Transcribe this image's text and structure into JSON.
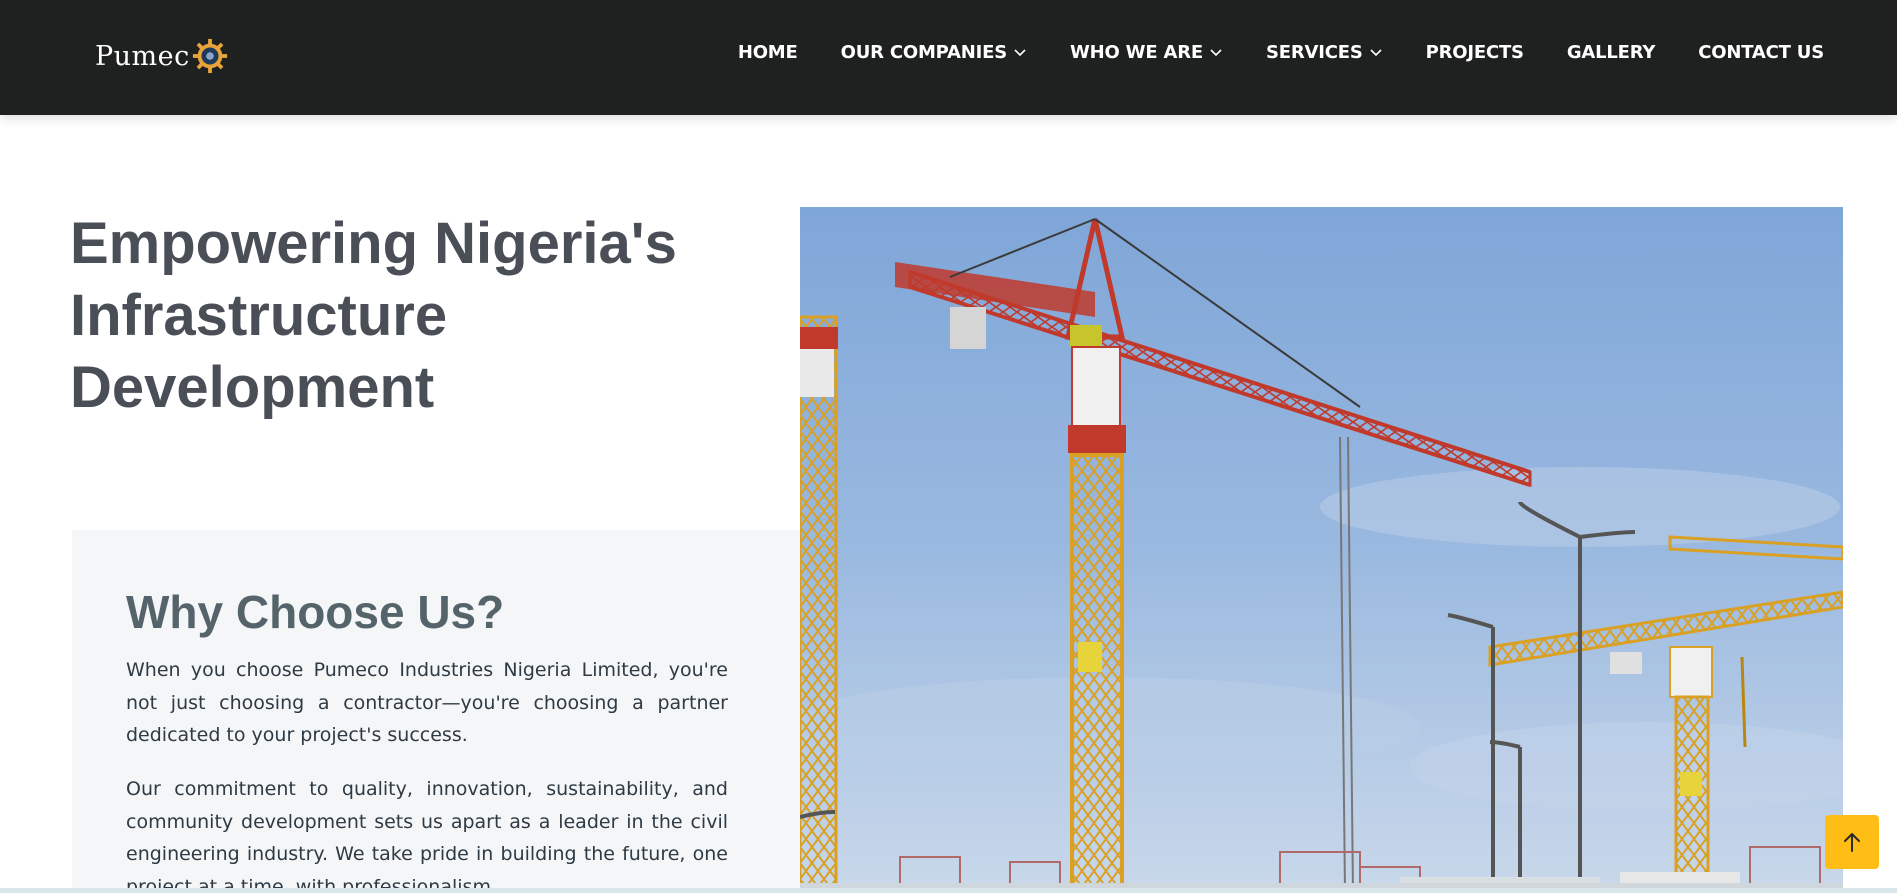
{
  "brand": {
    "name": "Pumec",
    "logo_icon": "gear-logo-icon",
    "accent": "#e8a33a"
  },
  "nav": {
    "items": [
      {
        "label": "HOME",
        "has_dropdown": false
      },
      {
        "label": "OUR COMPANIES",
        "has_dropdown": true
      },
      {
        "label": "WHO WE ARE",
        "has_dropdown": true
      },
      {
        "label": "SERVICES",
        "has_dropdown": true
      },
      {
        "label": "PROJECTS",
        "has_dropdown": false
      },
      {
        "label": "GALLERY",
        "has_dropdown": false
      },
      {
        "label": "CONTACT US",
        "has_dropdown": false
      }
    ]
  },
  "hero": {
    "title_lines": [
      "Empowering Nigeria's",
      "Infrastructure",
      "Development"
    ]
  },
  "why": {
    "title": "Why Choose Us?",
    "p1": "When you choose Pumeco Industries Nigeria Limited, you're not just choosing a contractor—you're choosing a partner dedicated to your project's success.",
    "p2": "Our commitment to quality, innovation, sustainability, and community development sets us apart as a leader in the civil engineering industry. We take pride in building the future, one project at a time, with professionalism"
  },
  "back_to_top": {
    "icon": "arrow-up-icon",
    "color": "#ffbd16"
  },
  "colors": {
    "header_bg": "#1f2020",
    "title": "#4a4f57",
    "panel_bg": "#f4f6f8"
  }
}
